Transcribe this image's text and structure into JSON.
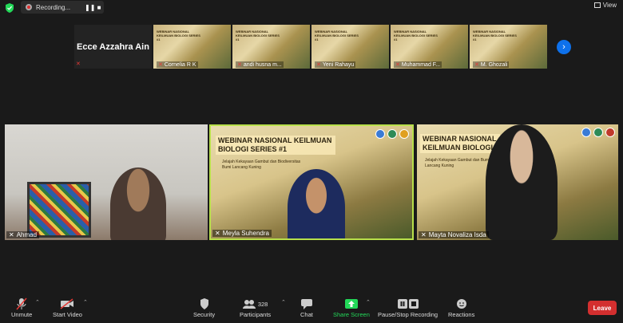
{
  "top": {
    "recording_label": "Recording...",
    "pause_glyph": "❚❚",
    "stop_glyph": "■",
    "view_label": "View"
  },
  "filmstrip": {
    "name_tile": "Ecce Azzahra Ain",
    "banner": "WEBINAR NASIONAL KEILMUAN BIOLOGI SERIES #1",
    "tiles": [
      {
        "name": "Cornelia R K"
      },
      {
        "name": "andi husna m..."
      },
      {
        "name": "Yeni Rahayu"
      },
      {
        "name": "Muhammad F..."
      },
      {
        "name": "M. Ghozali"
      }
    ]
  },
  "videos": {
    "v1_name": "Ahmad",
    "v2_name": "Meyla Suhendra",
    "v2_title": "WEBINAR NASIONAL KEILMUAN BIOLOGI SERIES #1",
    "v2_sub": "Jelajah Kekayaan Gambut dan Biodiversitas Bumi Lancang Kuning",
    "v3_name": "Mayta Novaliza Isda",
    "v3_title": "WEBINAR NASIONAL KEILMUAN BIOLOGI",
    "v3_sub": "Jelajah Kekayaan Gambut dan Bumi Lancang Kuning"
  },
  "toolbar": {
    "unmute": "Unmute",
    "start_video": "Start Video",
    "security": "Security",
    "participants": "Participants",
    "participants_count": "328",
    "chat": "Chat",
    "share_screen": "Share Screen",
    "pause_stop_recording": "Pause/Stop Recording",
    "reactions": "Reactions",
    "leave": "Leave"
  },
  "colors": {
    "accent_blue": "#0e71eb",
    "share_green": "#23d959",
    "leave_red": "#d32f2f",
    "active_speaker": "#b8e04a",
    "muted_red": "#e53935"
  }
}
